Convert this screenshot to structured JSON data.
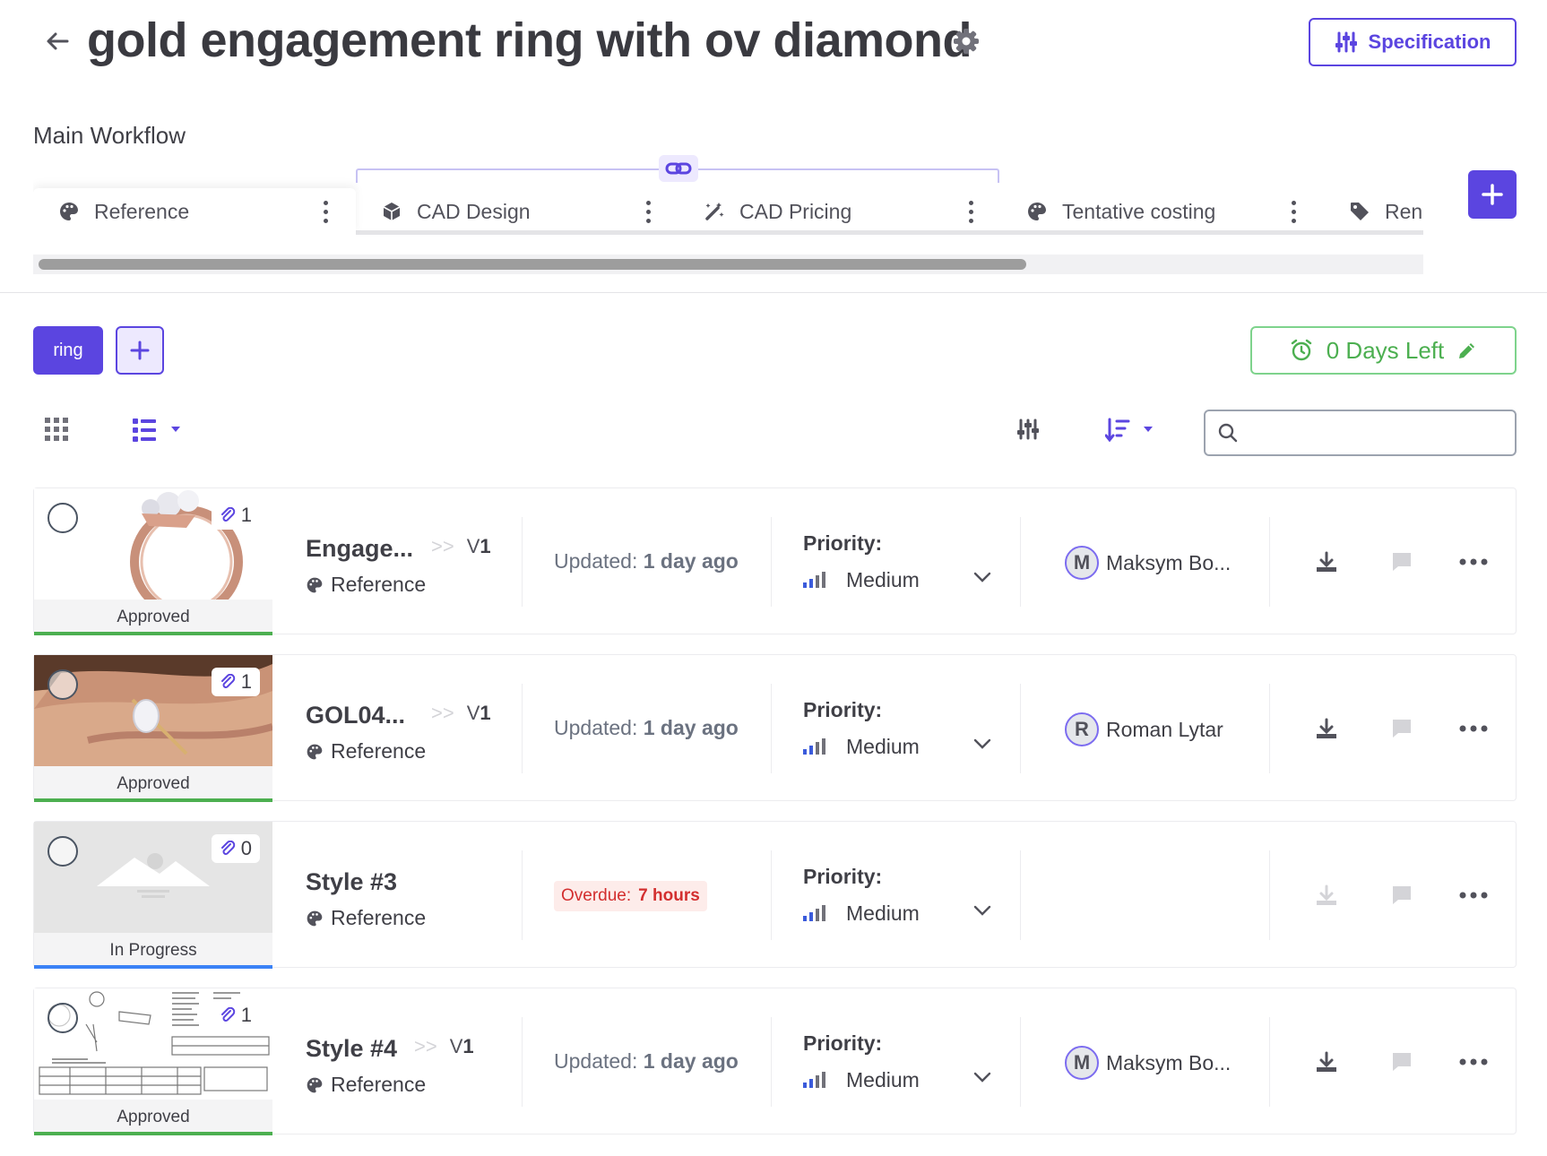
{
  "header": {
    "title": "gold engagement ring with ov diamond",
    "spec_label": "Specification"
  },
  "workflow": {
    "label": "Main Workflow",
    "tabs": [
      {
        "label": "Reference",
        "icon": "palette-icon",
        "active": true
      },
      {
        "label": "CAD Design",
        "icon": "cube-icon",
        "active": false
      },
      {
        "label": "CAD Pricing",
        "icon": "magic-wand-icon",
        "active": false
      },
      {
        "label": "Tentative costing",
        "icon": "palette-icon",
        "active": false
      },
      {
        "label": "Ren",
        "icon": "tag-icon",
        "active": false
      }
    ]
  },
  "tags": {
    "items": [
      "ring"
    ]
  },
  "deadline": {
    "label": "0 Days Left"
  },
  "search": {
    "value": "",
    "placeholder": ""
  },
  "rows": [
    {
      "name": "Engage...",
      "stage": "Reference",
      "version": "V",
      "version_num": "1",
      "attachments": "1",
      "status": "Approved",
      "time_prefix": "Updated:",
      "time_value": "1 day ago",
      "overdue": false,
      "priority_label": "Priority:",
      "priority": "Medium",
      "assignee_initial": "M",
      "assignee": "Maksym Bo..."
    },
    {
      "name": "GOL04...",
      "stage": "Reference",
      "version": "V",
      "version_num": "1",
      "attachments": "1",
      "status": "Approved",
      "time_prefix": "Updated:",
      "time_value": "1 day ago",
      "overdue": false,
      "priority_label": "Priority:",
      "priority": "Medium",
      "assignee_initial": "R",
      "assignee": "Roman Lytar"
    },
    {
      "name": "Style #3",
      "stage": "Reference",
      "version": "",
      "version_num": "",
      "attachments": "0",
      "status": "In Progress",
      "time_prefix": "Overdue:",
      "time_value": "7 hours",
      "overdue": true,
      "priority_label": "Priority:",
      "priority": "Medium",
      "assignee_initial": "",
      "assignee": ""
    },
    {
      "name": "Style #4",
      "stage": "Reference",
      "version": "V",
      "version_num": "1",
      "attachments": "1",
      "status": "Approved",
      "time_prefix": "Updated:",
      "time_value": "1 day ago",
      "overdue": false,
      "priority_label": "Priority:",
      "priority": "Medium",
      "assignee_initial": "M",
      "assignee": "Maksym Bo..."
    }
  ],
  "colors": {
    "accent": "#5b45e0",
    "approved": "#4caf50",
    "in_progress": "#3b82f6",
    "overdue": "#d32f2f",
    "deadline": "#4caf50"
  }
}
